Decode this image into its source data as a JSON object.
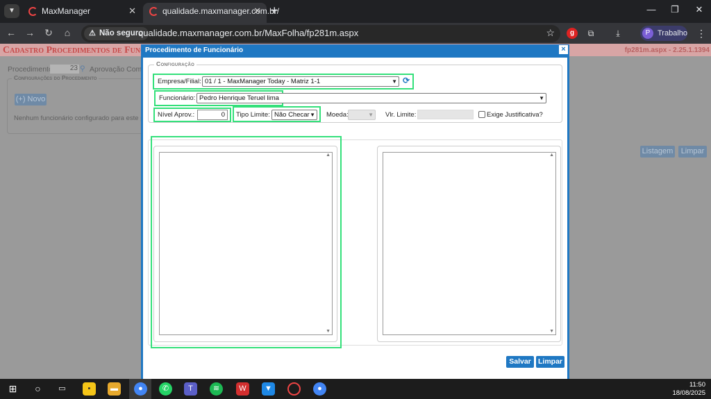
{
  "browser": {
    "tabs": [
      {
        "title": "MaxManager",
        "active": false
      },
      {
        "title": "qualidade.maxmanager.com.br/",
        "active": true
      }
    ],
    "security_label": "Não seguro",
    "url": "qualidade.maxmanager.com.br/MaxFolha/fp281m.aspx",
    "profile_label": "Trabalho",
    "profile_initial": "P"
  },
  "page": {
    "title": "Cadastro Procedimentos de Funcionário",
    "title_visible": "Cadastro Procedimentos de Func",
    "version": "fp281m.aspx - 2.25.1.1394",
    "procedimento_label": "Procedimento:",
    "procedimento_value": "23",
    "procedimento_desc": "Aprovação Comer",
    "section_title": "Configurações do Procedimento",
    "novo_button": "(+) Novo",
    "empty_message": "Nenhum funcionário configurado para este pr",
    "listagem_button": "Listagem",
    "limpar_button": "Limpar"
  },
  "modal": {
    "title": "Procedimento de Funcionário",
    "close_glyph": "×",
    "section_title": "Configuração",
    "empresa_label": "Empresa/Filial:",
    "empresa_value": "01 / 1 - MaxManager Today - Matriz 1-1",
    "funcionario_label": "Funcionário:",
    "funcionario_value": "Pedro Henrique Teruel lima",
    "nivel_label": "Nível Aprov.:",
    "nivel_value": "0",
    "tipo_limite_label": "Tipo Limite:",
    "tipo_limite_value": "Não Checar",
    "moeda_label": "Moeda:",
    "vlr_limite_label": "Vlr. Limite:",
    "exige_label": "Exige Justificativa?",
    "exige_checked": false,
    "salvar_button": "Salvar",
    "limpar_button": "Limpar"
  },
  "taskbar": {
    "time": "11:50",
    "date": "18/08/2025"
  },
  "colors": {
    "highlight": "#33e07a",
    "modal_blue": "#1f78c3",
    "page_title_red": "#c74a4a"
  }
}
